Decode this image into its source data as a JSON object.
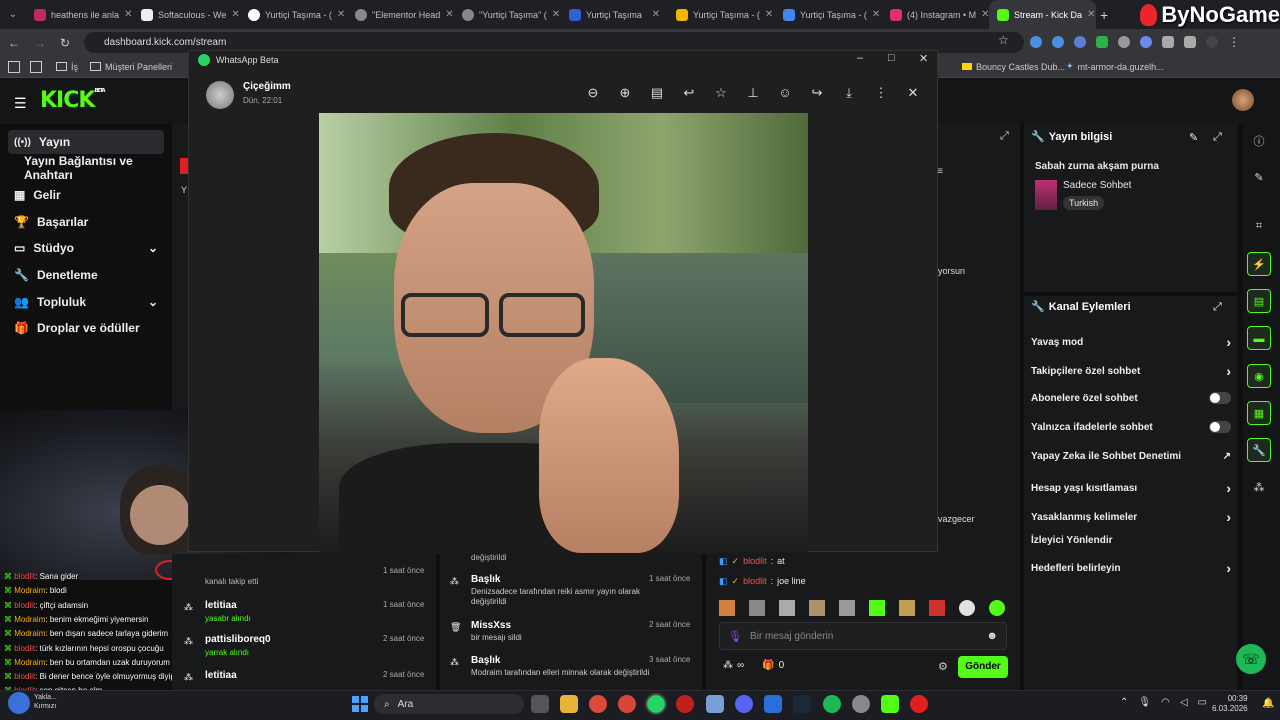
{
  "browser": {
    "tabs": [
      "heathens ile anla",
      "Softaculous - We",
      "Yurtiçi Taşıma - (",
      "\"Elementor Head",
      "\"Yurtiçi Taşıma\" (",
      "Yurtiçi Taşıma",
      "Yurtiçi Taşıma - (",
      "Yurtiçi Taşıma - (",
      "(4) Instagram • M",
      "Stream - Kick Da"
    ],
    "url": "dashboard.kick.com/stream",
    "bookmarks": [
      "İş",
      "Müşteri Panelleri",
      "Bouncy Castles Dub...",
      "mt-armor-da.guzelh..."
    ]
  },
  "watermark": "ByNoGame",
  "kick": {
    "logo": "KICK",
    "logo_badge": "BETA",
    "nav": [
      {
        "label": "Yayın",
        "icon": "broadcast-icon",
        "active": true
      },
      {
        "label": "Yayın Bağlantısı ve Anahtarı",
        "icon": "",
        "active": false
      },
      {
        "label": "Gelir",
        "icon": "revenue-icon",
        "active": false
      },
      {
        "label": "Başarılar",
        "icon": "trophy-icon",
        "active": false
      },
      {
        "label": "Stüdyo",
        "icon": "studio-icon",
        "active": false,
        "chevron": true
      },
      {
        "label": "Denetleme",
        "icon": "wrench-icon",
        "active": false
      },
      {
        "label": "Topluluk",
        "icon": "community-icon",
        "active": false,
        "chevron": true
      },
      {
        "label": "Droplar ve ödüller",
        "icon": "gift-icon",
        "active": false
      }
    ],
    "stream_info": {
      "title": "Yayın bilgisi",
      "stream_title": "Sabah zurna akşam purna",
      "category": "Sadece Sohbet",
      "language": "Turkish"
    },
    "channel_actions": {
      "title": "Kanal Eylemleri",
      "items": [
        {
          "label": "Yavaş mod",
          "control": "chevron"
        },
        {
          "label": "Takipçilere özel sohbet",
          "control": "chevron"
        },
        {
          "label": "Abonelere özel sohbet",
          "control": "toggle"
        },
        {
          "label": "Yalnızca ifadelerle sohbet",
          "control": "toggle"
        },
        {
          "label": "Yapay Zeka ile Sohbet Denetimi",
          "control": "external"
        },
        {
          "label": "Hesap yaşı kısıtlaması",
          "control": "chevron"
        },
        {
          "label": "Yasaklanmış kelimeler",
          "control": "chevron"
        },
        {
          "label": "İzleyici Yönlendir",
          "control": "none"
        },
        {
          "label": "Hedefleri belirleyin",
          "control": "chevron"
        }
      ]
    },
    "partial_texts": {
      "mid_right": "yorsun",
      "vazgecer": "vazgecer",
      "side_y": "Y"
    },
    "activity_left": [
      {
        "text": "kanalı takip etti",
        "user": "",
        "time": "1 saat önce"
      },
      {
        "text": "letitiaa",
        "user": "yasabr alındı",
        "time": "1 saat önce"
      },
      {
        "text": "pattisliboreq0",
        "user": "yarrak alındı",
        "time": "2 saat önce"
      },
      {
        "text": "letitiaa",
        "user": "",
        "time": "2 saat önce"
      }
    ],
    "activity_mid": [
      {
        "head": "değiştirildi",
        "body": "",
        "time": ""
      },
      {
        "head": "Başlık",
        "body": "Denizsadece tarafından reiki asmır yayın olarak değiştirildi",
        "time": "1 saat önce"
      },
      {
        "head": "MissXss",
        "body": "bir mesajı sildi",
        "time": "2 saat önce"
      },
      {
        "head": "Başlık",
        "body": "Modraim tarafından elleri minnak olarak değiştirildi",
        "time": "3 saat önce"
      }
    ],
    "chat": {
      "lines": [
        {
          "user": "blodlit",
          "msg": "at"
        },
        {
          "user": "blodlit",
          "msg": "joe line"
        }
      ],
      "placeholder": "Bir mesaj gönderin",
      "send": "Gönder",
      "points": "0"
    }
  },
  "whatsapp": {
    "app_title": "WhatsApp Beta",
    "contact": "Çiçeğimm",
    "time": "Dün, 22:01"
  },
  "overlay_chat": [
    {
      "user": "blodlit",
      "msg": "Sana gider",
      "color": "#ff4d4d"
    },
    {
      "user": "Modraim",
      "msg": "blodi",
      "color": "#ffb400"
    },
    {
      "user": "blodlit",
      "msg": "çiftçi adamsin",
      "color": "#ff4d4d"
    },
    {
      "user": "Modraim",
      "msg": "benim ekmeğimi yiyemersin",
      "color": "#ffb400"
    },
    {
      "user": "Modraim",
      "msg": "ben dışarı sadece tarlaya giderim",
      "color": "#ffb400"
    },
    {
      "user": "blodlit",
      "msg": "türk kızlarının hepsi orospu çocuğu",
      "color": "#ff4d4d"
    },
    {
      "user": "Modraim",
      "msg": "ben bu ortamdan uzak duruyorum",
      "color": "#ffb400"
    },
    {
      "user": "blodlit",
      "msg": "Bi dener bence öyle olmuyormuş diyip vazgeçer",
      "color": "#ff4d4d"
    },
    {
      "user": "blodlit",
      "msg": "sen gitcen be olm",
      "color": "#ff4d4d"
    },
    {
      "user": "blodlit",
      "msg": "joe line",
      "color": "#ff4d4d"
    }
  ],
  "taskbar": {
    "search": "Ara",
    "time": "00:39",
    "date": "6.03.2026",
    "weather": "Yakla...",
    "weather2": "Kırmızı"
  }
}
